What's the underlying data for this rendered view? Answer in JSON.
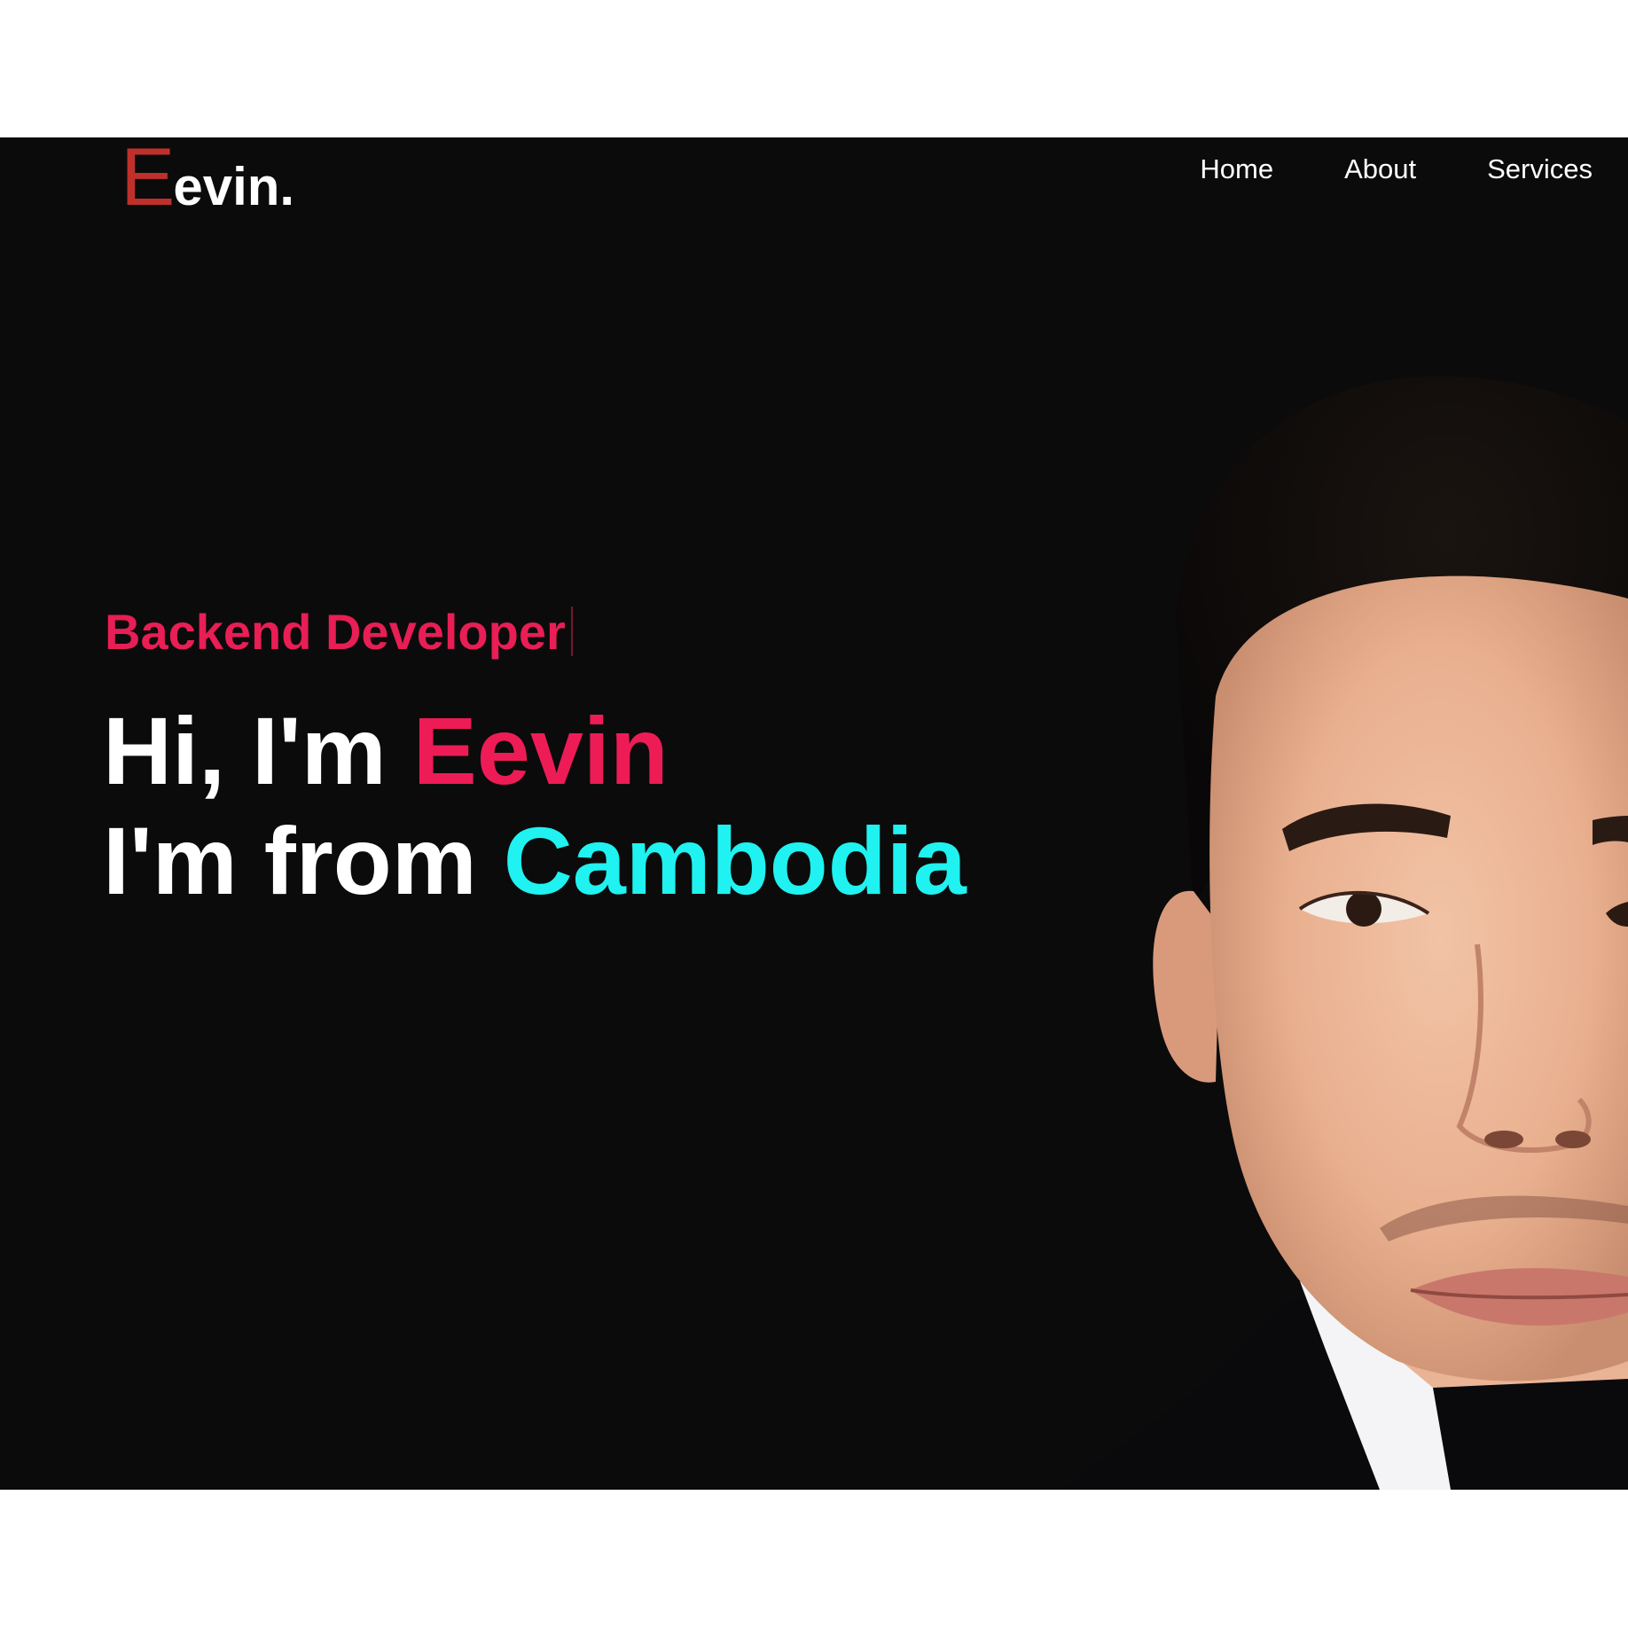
{
  "header": {
    "logo_initial": "E",
    "logo_rest": "evin.",
    "nav": [
      {
        "label": "Home"
      },
      {
        "label": "About"
      },
      {
        "label": "Services"
      }
    ]
  },
  "hero": {
    "subtitle": "Backend Developer",
    "line1_prefix": "Hi, I'm ",
    "line1_name": "Eevin",
    "line2_prefix": "I'm from ",
    "line2_country": "Cambodia"
  },
  "colors": {
    "background": "#0b0b0c",
    "logo_accent": "#c0302a",
    "pink_accent": "#ee1c56",
    "cyan_accent": "#1ff2f0",
    "text": "#ffffff"
  }
}
